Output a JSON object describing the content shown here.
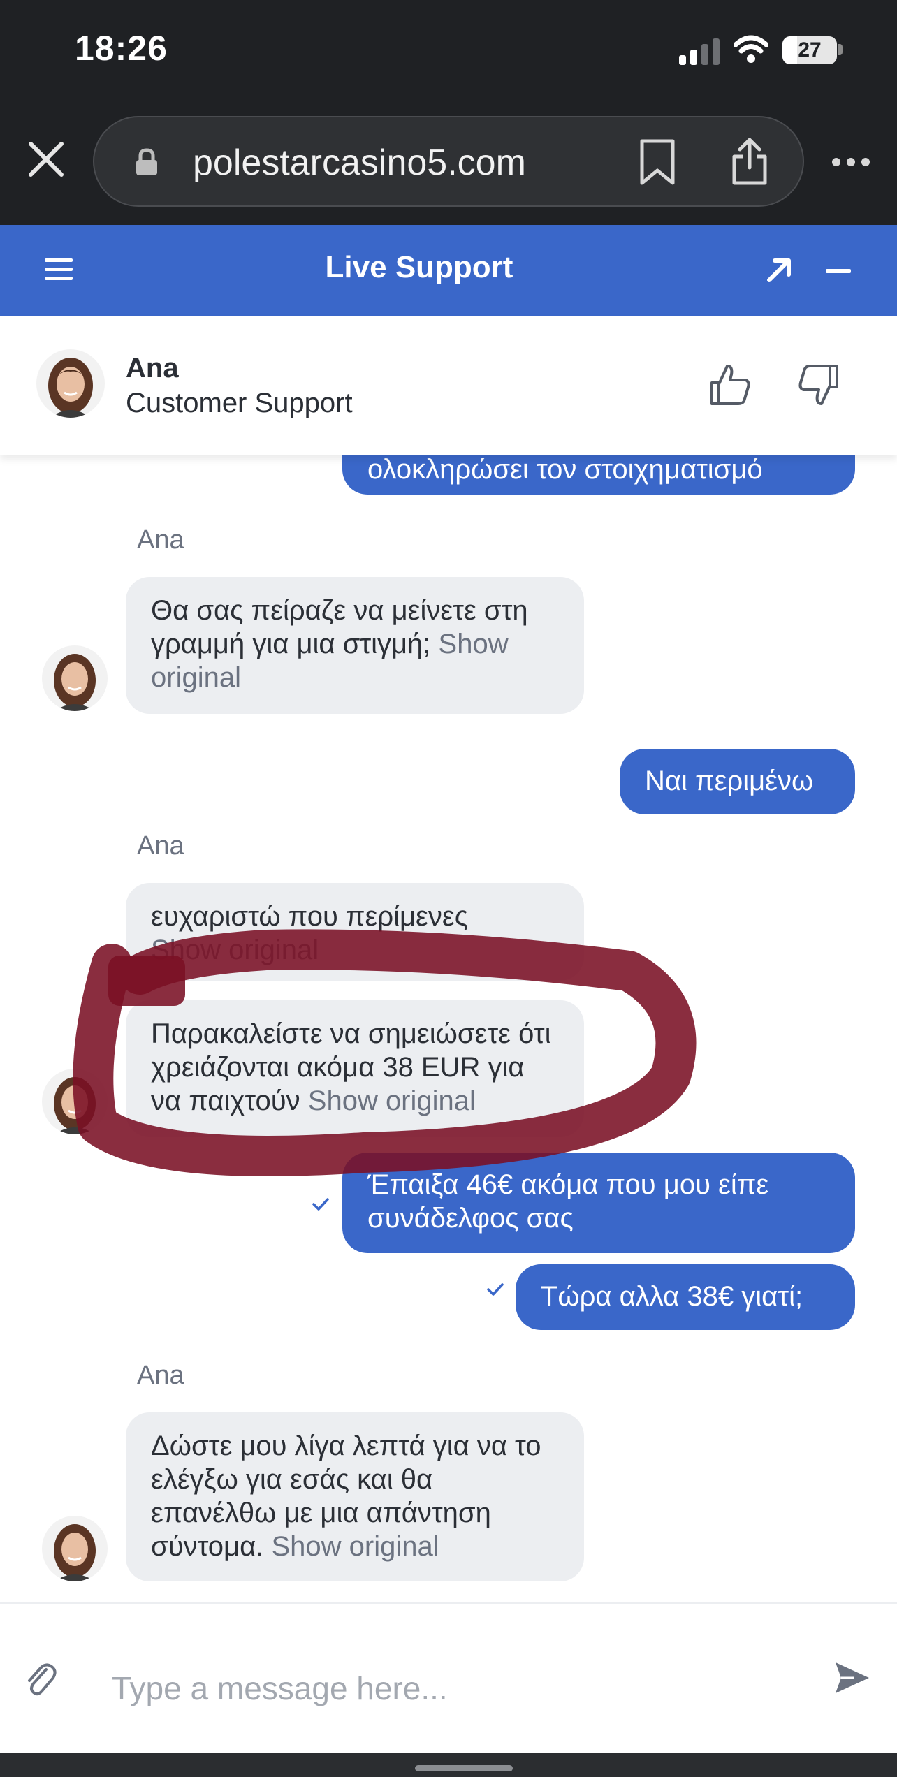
{
  "status_bar": {
    "time": "18:26",
    "battery": "27",
    "battery_level": 0.27
  },
  "browser": {
    "url": "polestarcasino5.com"
  },
  "header": {
    "title": "Live Support"
  },
  "agent": {
    "name": "Ana",
    "role": "Customer Support"
  },
  "messages": {
    "user_0": "ολοκληρώσει τον στοιχηματισμό",
    "sender_1": "Ana",
    "agent_1": "Θα σας πείραζε να μείνετε στη γραμμή για μια στιγμή;",
    "user_2": "Ναι περιμένω",
    "sender_3": "Ana",
    "agent_3a": "ευχαριστώ που περίμενες",
    "agent_3b": "Παρακαλείστε να σημειώσετε ότι χρειάζονται ακόμα 38 EUR για να παιχτούν",
    "user_4": "Έπαιξα 46€ ακόμα που μου είπε συνάδελφος σας",
    "user_5": "Τώρα αλλα 38€ γιατί;",
    "sender_6": "Ana",
    "agent_6": "Δώστε μου λίγα λεπτά για να το ελέγξω για εσάς και θα επανέλθω με μια απάντηση σύντομα."
  },
  "labels": {
    "show_original": "Show original"
  },
  "composer": {
    "placeholder": "Type a message here..."
  },
  "colors": {
    "accent": "#3a67c9",
    "agent_bubble": "#eceef1",
    "scribble": "#7a1024",
    "browser_chrome": "#1f2124"
  }
}
